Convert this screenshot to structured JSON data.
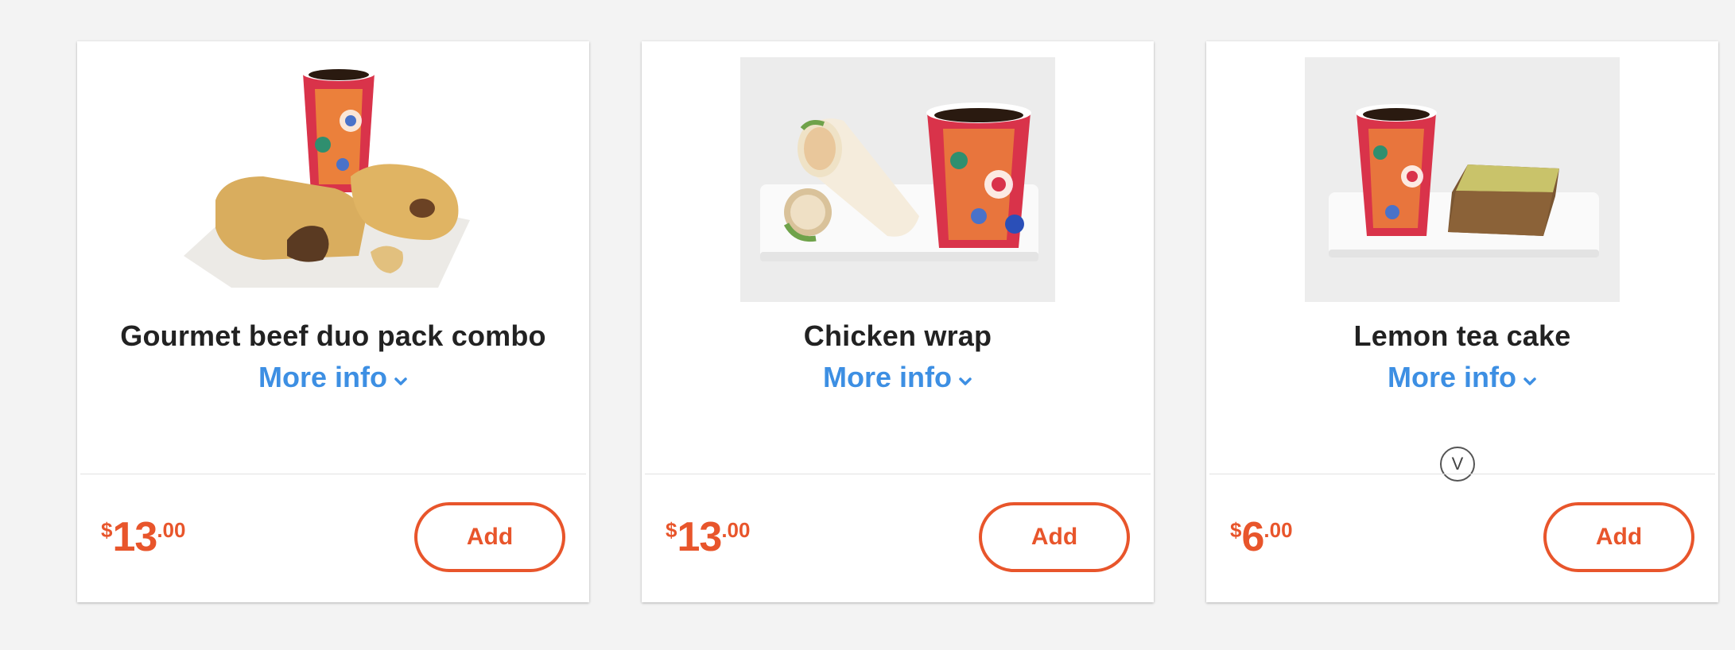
{
  "products": [
    {
      "title": "Gourmet beef duo pack combo",
      "more_info_label": "More info",
      "price": {
        "currency": "$",
        "dollars": "13",
        "cents": ".00"
      },
      "add_label": "Add"
    },
    {
      "title": "Chicken wrap",
      "more_info_label": "More info",
      "price": {
        "currency": "$",
        "dollars": "13",
        "cents": ".00"
      },
      "add_label": "Add"
    },
    {
      "title": "Lemon tea cake",
      "more_info_label": "More info",
      "badge": "V",
      "price": {
        "currency": "$",
        "dollars": "6",
        "cents": ".00"
      },
      "add_label": "Add"
    }
  ],
  "colors": {
    "accent": "#e8552b",
    "link": "#3d8fe3",
    "page_bg": "#f3f3f3",
    "text": "#222222"
  },
  "icons": {
    "more_info": "chevron-down-icon",
    "vegetarian": "vegetarian-badge-icon"
  }
}
